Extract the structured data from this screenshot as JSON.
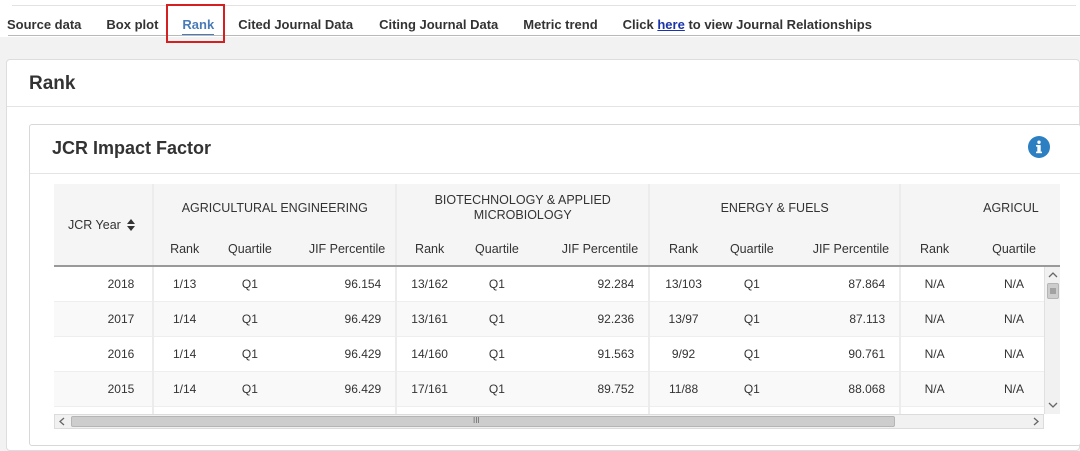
{
  "tabs": [
    {
      "label": "Source data"
    },
    {
      "label": "Box plot"
    },
    {
      "label": "Rank"
    },
    {
      "label": "Cited Journal Data"
    },
    {
      "label": "Citing Journal Data"
    },
    {
      "label": "Metric trend"
    }
  ],
  "relationships_link": {
    "prefix": "Click ",
    "link_text": "here",
    "suffix": " to view Journal Relationships"
  },
  "active_tab": "Rank",
  "rank_panel": {
    "title": "Rank"
  },
  "jcr_card": {
    "title": "JCR Impact Factor",
    "info_icon": "info-icon"
  },
  "table": {
    "year_header": "JCR Year",
    "sort_icon": "sort-updown-icon",
    "groups": [
      {
        "name": "AGRICULTURAL ENGINEERING",
        "columns": [
          "Rank",
          "Quartile",
          "JIF Percentile"
        ]
      },
      {
        "name": "BIOTECHNOLOGY & APPLIED MICROBIOLOGY",
        "columns": [
          "Rank",
          "Quartile",
          "JIF Percentile"
        ]
      },
      {
        "name": "ENERGY & FUELS",
        "columns": [
          "Rank",
          "Quartile",
          "JIF Percentile"
        ]
      },
      {
        "name": "AGRICUL",
        "columns": [
          "Rank",
          "Quartile"
        ]
      }
    ],
    "rows": [
      {
        "year": "2018",
        "cells": [
          [
            "1/13",
            "Q1",
            "96.154"
          ],
          [
            "13/162",
            "Q1",
            "92.284"
          ],
          [
            "13/103",
            "Q1",
            "87.864"
          ],
          [
            "N/A",
            "N/A"
          ]
        ]
      },
      {
        "year": "2017",
        "cells": [
          [
            "1/14",
            "Q1",
            "96.429"
          ],
          [
            "13/161",
            "Q1",
            "92.236"
          ],
          [
            "13/97",
            "Q1",
            "87.113"
          ],
          [
            "N/A",
            "N/A"
          ]
        ]
      },
      {
        "year": "2016",
        "cells": [
          [
            "1/14",
            "Q1",
            "96.429"
          ],
          [
            "14/160",
            "Q1",
            "91.563"
          ],
          [
            "9/92",
            "Q1",
            "90.761"
          ],
          [
            "N/A",
            "N/A"
          ]
        ]
      },
      {
        "year": "2015",
        "cells": [
          [
            "1/14",
            "Q1",
            "96.429"
          ],
          [
            "17/161",
            "Q1",
            "89.752"
          ],
          [
            "11/88",
            "Q1",
            "88.068"
          ],
          [
            "N/A",
            "N/A"
          ]
        ]
      },
      {
        "year": "",
        "cells": [
          [
            "",
            "",
            ""
          ],
          [
            "",
            "",
            ""
          ],
          [
            "",
            "",
            ""
          ],
          [
            "",
            ""
          ]
        ]
      }
    ]
  },
  "scrollbars": {
    "horizontal_grip": "III"
  },
  "colors": {
    "active_tab": "#4a7bb7",
    "highlight_box": "#d42020",
    "link": "#1a33aa",
    "info_icon": "#2c7fc1"
  }
}
